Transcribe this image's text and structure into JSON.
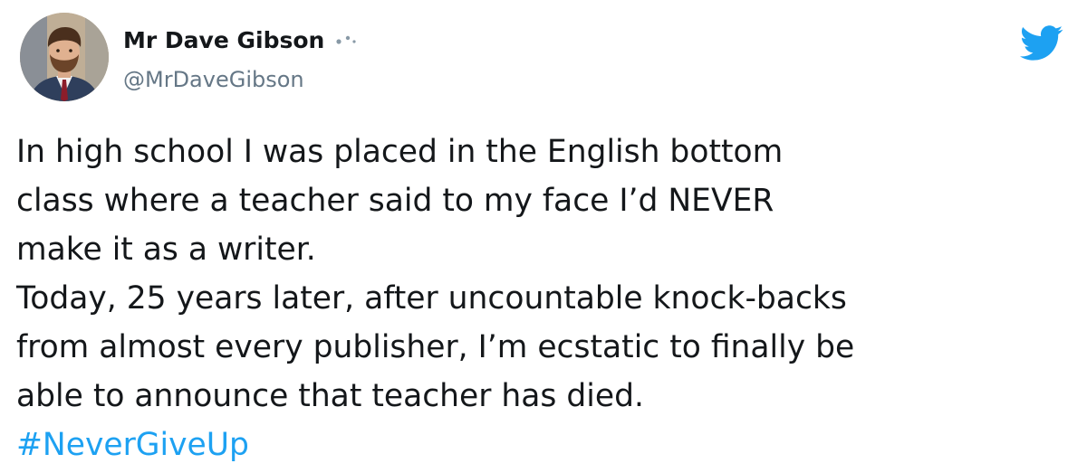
{
  "tweet": {
    "author": {
      "display_name": "Mr Dave Gibson",
      "handle": "@MrDaveGibson",
      "name_suffix_icon": "dots-icon",
      "avatar": "avatar-photo"
    },
    "platform_icon": "twitter-bird-icon",
    "text_lines": [
      "In high school I was placed in the English bottom",
      "class where a teacher said to my face I’d NEVER",
      "make it as a writer.",
      "Today, 25 years later, after uncountable knock-backs",
      "from almost every publisher, I’m ecstatic to finally be",
      "able to announce that teacher has died."
    ],
    "hashtag": "#NeverGiveUp",
    "colors": {
      "accent": "#1da1f2",
      "text": "#14171a",
      "secondary_text": "#657786",
      "background": "#ffffff"
    }
  }
}
